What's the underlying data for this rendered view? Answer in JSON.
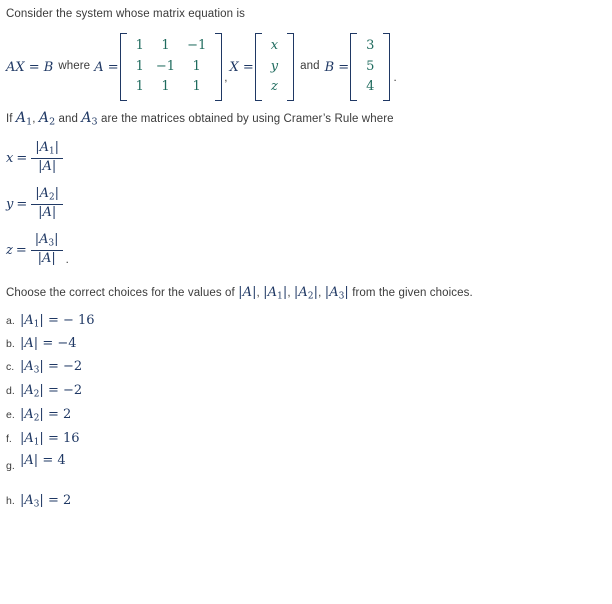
{
  "intro": {
    "line1": "Consider the system whose matrix equation is"
  },
  "equation": {
    "lhs": "AX = B",
    "where_label": "where",
    "a_label": "A =",
    "matrix_a": {
      "rows": [
        [
          "1",
          "1",
          "−1"
        ],
        [
          "1",
          "−1",
          "1"
        ],
        [
          "1",
          "1",
          "1"
        ]
      ]
    },
    "comma": ",",
    "x_label": "X =",
    "matrix_x": {
      "rows": [
        [
          "x"
        ],
        [
          "y"
        ],
        [
          "z"
        ]
      ]
    },
    "and_label": "and",
    "b_label": "B =",
    "matrix_b": {
      "rows": [
        [
          "3"
        ],
        [
          "5"
        ],
        [
          "4"
        ]
      ]
    },
    "period": "."
  },
  "cramer": {
    "prefix": "If",
    "var1": "A",
    "var1_sub": "1",
    "sep1": ",",
    "var2": "A",
    "var2_sub": "2",
    "sep2": "and",
    "var3": "A",
    "var3_sub": "3",
    "suffix": "are the matrices obtained by using Cramer’s Rule where",
    "fractions": [
      {
        "lhs": "x",
        "eq": "=",
        "numerator_var": "A",
        "numerator_sub": "1",
        "denominator_var": "A",
        "trailing": ""
      },
      {
        "lhs": "y",
        "eq": "=",
        "numerator_var": "A",
        "numerator_sub": "2",
        "denominator_var": "A",
        "trailing": ""
      },
      {
        "lhs": "z",
        "eq": "=",
        "numerator_var": "A",
        "numerator_sub": "3",
        "denominator_var": "A",
        "trailing": "."
      }
    ]
  },
  "choose": {
    "text_before": "Choose the correct choices for the values of",
    "dets": [
      {
        "var": "A",
        "sub": ""
      },
      {
        "var": "A",
        "sub": "1"
      },
      {
        "var": "A",
        "sub": "2"
      },
      {
        "var": "A",
        "sub": "3"
      }
    ],
    "text_after": "from the given choices."
  },
  "options": [
    {
      "marker": "a.",
      "var": "A",
      "sub": "1",
      "eq": "=",
      "value": "− 16",
      "low_marker": false
    },
    {
      "marker": "b.",
      "var": "A",
      "sub": "",
      "eq": "=",
      "value": "−4",
      "low_marker": false
    },
    {
      "marker": "c.",
      "var": "A",
      "sub": "3",
      "eq": "=",
      "value": "−2",
      "low_marker": false
    },
    {
      "marker": "d.",
      "var": "A",
      "sub": "2",
      "eq": "=",
      "value": "−2",
      "low_marker": false
    },
    {
      "marker": "e.",
      "var": "A",
      "sub": "2",
      "eq": "=",
      "value": "2",
      "low_marker": false
    },
    {
      "marker": "f.",
      "var": "A",
      "sub": "1",
      "eq": "=",
      "value": "16",
      "low_marker": false
    },
    {
      "marker": "g.",
      "var": "A",
      "sub": "",
      "eq": "=",
      "value": "4",
      "low_marker": true
    },
    {
      "marker": "h.",
      "var": "A",
      "sub": "3",
      "eq": "=",
      "value": "2",
      "low_marker": false
    }
  ],
  "colors": {
    "body_text": "#3b3b3b",
    "math_navy": "#1f3864",
    "matrix_number_teal": "#1f6b5e",
    "background": "#ffffff"
  }
}
